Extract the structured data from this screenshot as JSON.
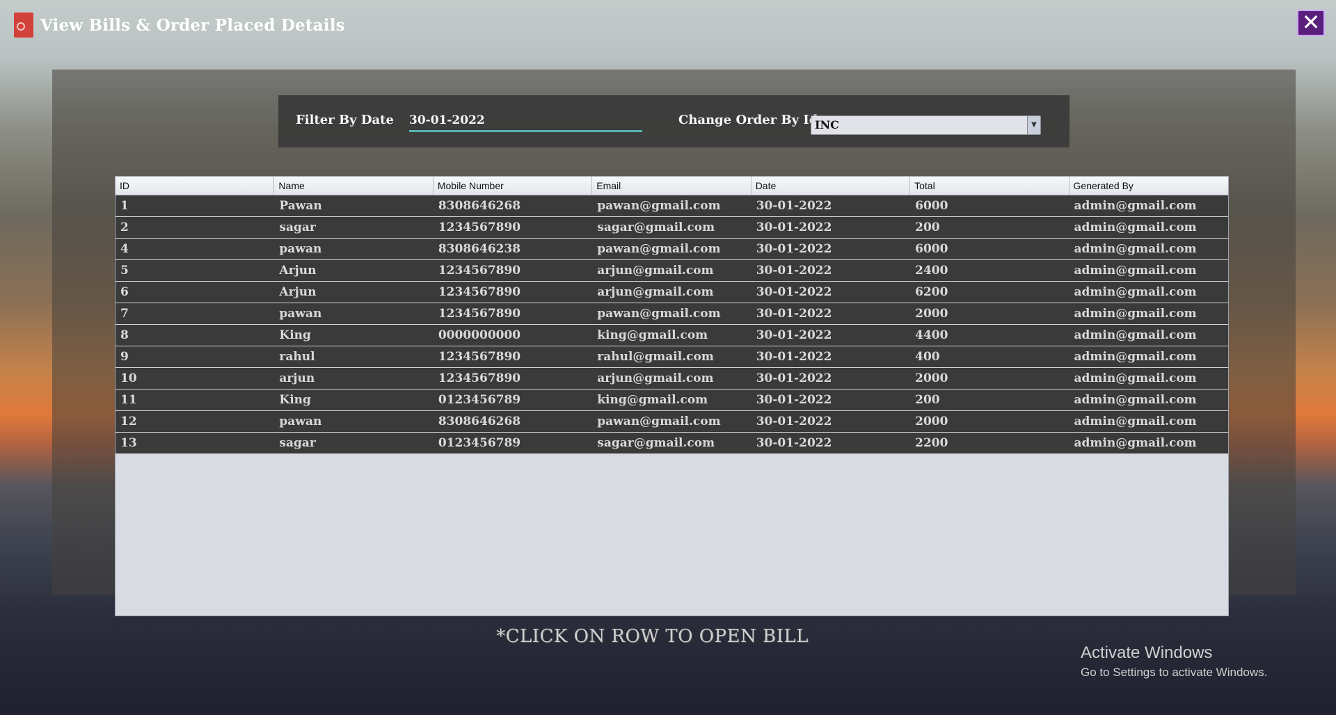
{
  "window": {
    "title": "View Bills & Order Placed Details",
    "close_symbol": "✕"
  },
  "filter": {
    "date_label": "Filter By Date",
    "date_value": "30-01-2022",
    "order_label": "Change Order By Id",
    "order_value": "INC"
  },
  "table": {
    "columns": [
      "ID",
      "Name",
      "Mobile Number",
      "Email",
      "Date",
      "Total",
      "Generated By"
    ],
    "rows": [
      [
        "1",
        "Pawan",
        "8308646268",
        "pawan@gmail.com",
        "30-01-2022",
        "6000",
        "admin@gmail.com"
      ],
      [
        "2",
        "sagar",
        "1234567890",
        "sagar@gmail.com",
        "30-01-2022",
        "200",
        "admin@gmail.com"
      ],
      [
        "4",
        "pawan",
        "8308646238",
        "pawan@gmail.com",
        "30-01-2022",
        "6000",
        "admin@gmail.com"
      ],
      [
        "5",
        "Arjun",
        "1234567890",
        "arjun@gmail.com",
        "30-01-2022",
        "2400",
        "admin@gmail.com"
      ],
      [
        "6",
        "Arjun",
        "1234567890",
        "arjun@gmail.com",
        "30-01-2022",
        "6200",
        "admin@gmail.com"
      ],
      [
        "7",
        "pawan",
        "1234567890",
        "pawan@gmail.com",
        "30-01-2022",
        "2000",
        "admin@gmail.com"
      ],
      [
        "8",
        "King",
        "0000000000",
        "king@gmail.com",
        "30-01-2022",
        "4400",
        "admin@gmail.com"
      ],
      [
        "9",
        "rahul",
        "1234567890",
        "rahul@gmail.com",
        "30-01-2022",
        "400",
        "admin@gmail.com"
      ],
      [
        "10",
        "arjun",
        "1234567890",
        "arjun@gmail.com",
        "30-01-2022",
        "2000",
        "admin@gmail.com"
      ],
      [
        "11",
        "King",
        "0123456789",
        "king@gmail.com",
        "30-01-2022",
        "200",
        "admin@gmail.com"
      ],
      [
        "12",
        "pawan",
        "8308646268",
        "pawan@gmail.com",
        "30-01-2022",
        "2000",
        "admin@gmail.com"
      ],
      [
        "13",
        "sagar",
        "0123456789",
        "sagar@gmail.com",
        "30-01-2022",
        "2200",
        "admin@gmail.com"
      ]
    ]
  },
  "hint": "*CLICK ON ROW TO OPEN BILL",
  "watermark": {
    "title": "Activate Windows",
    "subtitle": "Go to Settings to activate Windows."
  }
}
